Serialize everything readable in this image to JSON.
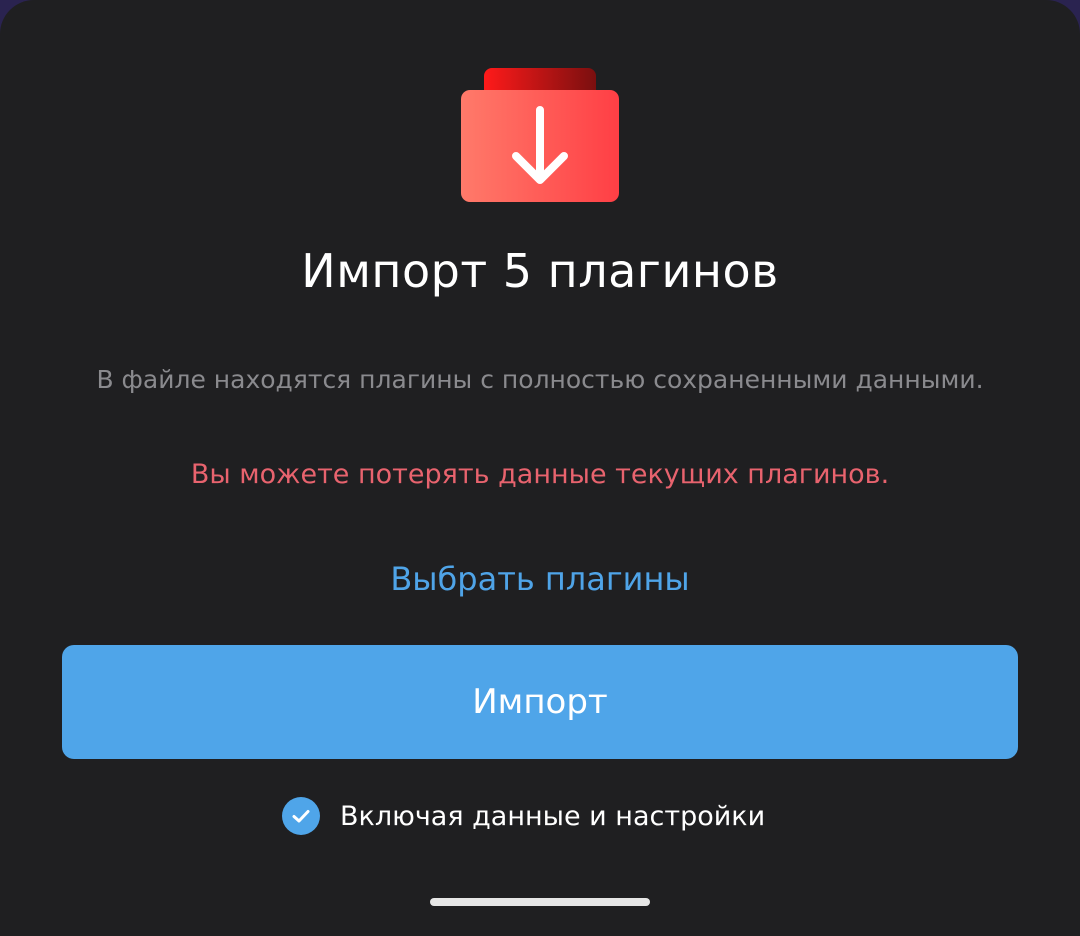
{
  "dialog": {
    "icon": "import-folder-download-icon",
    "title": "Импорт 5 плагинов",
    "description": "В файле находятся плагины с полностью сохраненными данными.",
    "warning": "Вы можете потерять данные текущих плагинов.",
    "select_plugins_label": "Выбрать плагины",
    "import_button_label": "Импорт",
    "include_data_checkbox": {
      "label": "Включая данные и настройки",
      "checked": true
    }
  },
  "colors": {
    "sheet_background": "#1f1f21",
    "accent_blue": "#4fa5e9",
    "warning_red": "#e8636e",
    "icon_red": "#ff4f4f",
    "muted_text": "#8a8a8e"
  }
}
